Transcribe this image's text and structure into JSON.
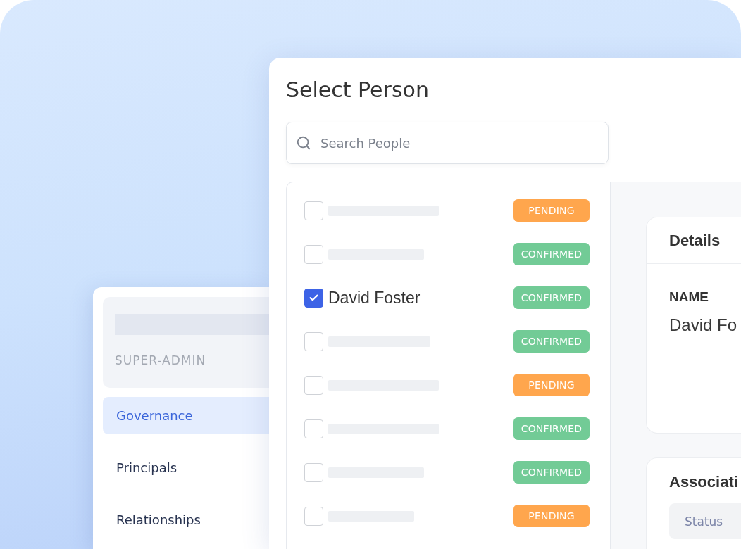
{
  "sidebar": {
    "role": "SUPER-ADMIN",
    "items": [
      {
        "label": "Governance",
        "selected": true
      },
      {
        "label": "Principals",
        "selected": false
      },
      {
        "label": "Relationships",
        "selected": false
      }
    ]
  },
  "dialog": {
    "title": "Select Person",
    "search": {
      "placeholder": "Search People"
    },
    "people": [
      {
        "kind": "skeleton",
        "checked": false,
        "status": "PENDING",
        "color": "#ffa64d"
      },
      {
        "kind": "skeleton",
        "checked": false,
        "status": "CONFIRMED",
        "color": "#72cb96"
      },
      {
        "kind": "named",
        "name": "David Foster",
        "checked": true,
        "status": "CONFIRMED",
        "color": "#72cb96"
      },
      {
        "kind": "skeleton",
        "checked": false,
        "status": "CONFIRMED",
        "color": "#72cb96"
      },
      {
        "kind": "skeleton",
        "checked": false,
        "status": "PENDING",
        "color": "#ffa64d"
      },
      {
        "kind": "skeleton",
        "checked": false,
        "status": "CONFIRMED",
        "color": "#72cb96"
      },
      {
        "kind": "skeleton",
        "checked": false,
        "status": "CONFIRMED",
        "color": "#72cb96"
      },
      {
        "kind": "skeleton",
        "checked": false,
        "status": "PENDING",
        "color": "#ffa64d"
      }
    ],
    "details": {
      "title": "Details",
      "fields": [
        {
          "label": "NAME",
          "value": "David Fo"
        }
      ]
    },
    "associations": {
      "title": "Associati",
      "columns": [
        "Status"
      ]
    }
  }
}
